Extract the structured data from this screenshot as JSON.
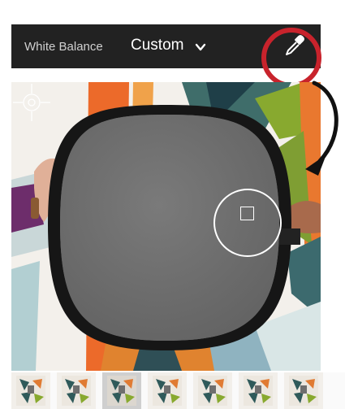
{
  "toolbar": {
    "white_balance_label": "White Balance",
    "white_balance_value": "Custom",
    "dropdown_icon": "chevron-down-icon",
    "eyedropper_icon": "eyedropper-icon",
    "highlight_color": "#c8232c",
    "background_color": "#222222"
  },
  "photo": {
    "description_icons": [
      "crosshair-icon",
      "sampler-target-icon",
      "curved-arrow-icon"
    ],
    "card_color": "#6e6e6e"
  },
  "filmstrip": {
    "thumbnail_count": 7,
    "selected_index": 2
  }
}
